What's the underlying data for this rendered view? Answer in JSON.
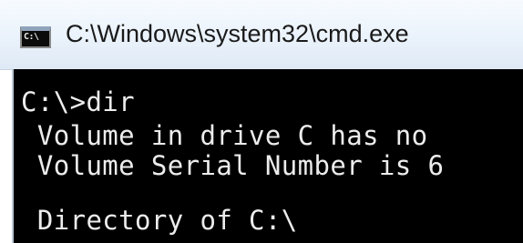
{
  "window": {
    "title": "C:\\Windows\\system32\\cmd.exe",
    "icon": "cmd-icon",
    "icon_text": "C:\\"
  },
  "console": {
    "lines": [
      "C:\\>dir",
      " Volume in drive C has no",
      " Volume Serial Number is 6",
      " Directory of C:\\"
    ]
  },
  "colors": {
    "console_background": "#000000",
    "console_text": "#ececec",
    "titlebar": "#eaf2fb"
  }
}
